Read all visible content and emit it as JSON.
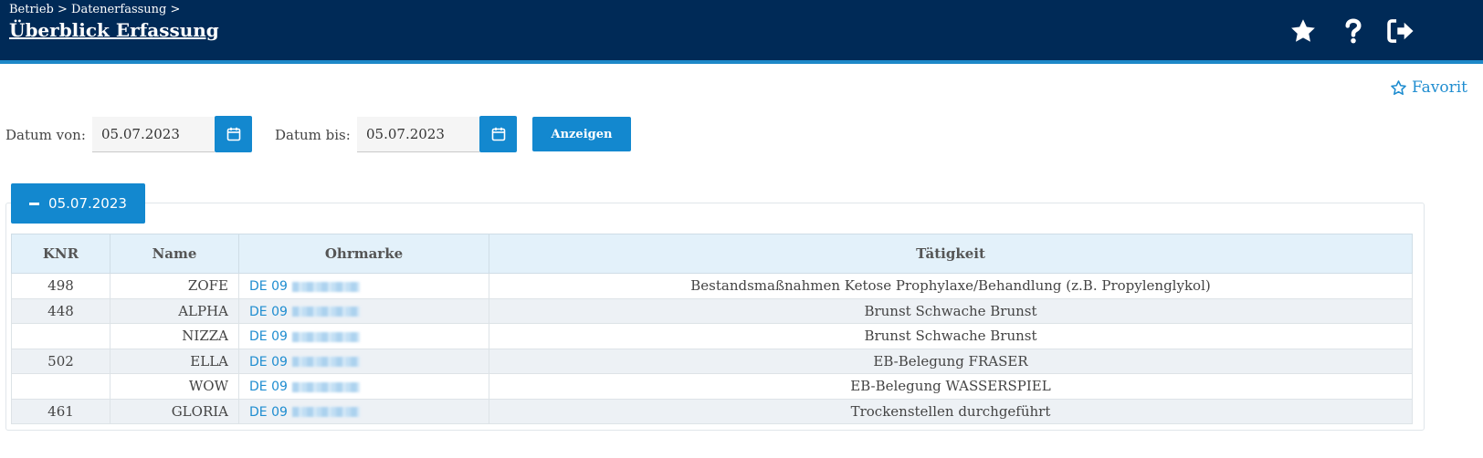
{
  "header": {
    "breadcrumb": "Betrieb > Datenerfassung >",
    "title": "Überblick Erfassung",
    "icons": [
      "star-icon",
      "help-icon",
      "logout-icon"
    ]
  },
  "favorite": {
    "label": "Favorit"
  },
  "filter": {
    "date_from_label": "Datum von:",
    "date_from_value": "05.07.2023",
    "date_to_label": "Datum bis:",
    "date_to_value": "05.07.2023",
    "show_button": "Anzeigen"
  },
  "group": {
    "label": "05.07.2023"
  },
  "table": {
    "columns": [
      "KNR",
      "Name",
      "Ohrmarke",
      "Tätigkeit"
    ],
    "rows": [
      {
        "knr": "498",
        "name": "ZOFE",
        "ohrmarke": "DE 09",
        "taetigkeit": "Bestandsmaßnahmen Ketose Prophylaxe/Behandlung (z.B. Propylenglykol)"
      },
      {
        "knr": "448",
        "name": "ALPHA",
        "ohrmarke": "DE 09",
        "taetigkeit": "Brunst Schwache Brunst"
      },
      {
        "knr": "",
        "name": "NIZZA",
        "ohrmarke": "DE 09",
        "taetigkeit": "Brunst Schwache Brunst"
      },
      {
        "knr": "502",
        "name": "ELLA",
        "ohrmarke": "DE 09",
        "taetigkeit": "EB-Belegung FRASER"
      },
      {
        "knr": "",
        "name": "WOW",
        "ohrmarke": "DE 09",
        "taetigkeit": "EB-Belegung WASSERSPIEL"
      },
      {
        "knr": "461",
        "name": "GLORIA",
        "ohrmarke": "DE 09",
        "taetigkeit": "Trockenstellen durchgeführt"
      }
    ]
  },
  "colors": {
    "header_bg": "#002a57",
    "accent": "#1388cf",
    "link": "#1f8dd0",
    "table_header_bg": "#e3f1fa"
  }
}
